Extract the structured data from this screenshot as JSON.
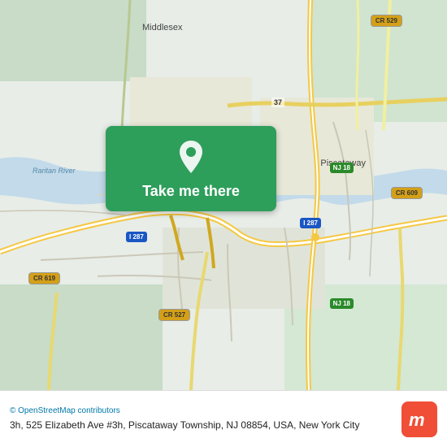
{
  "map": {
    "center_lat": 40.5625,
    "center_lng": -74.4702,
    "zoom": 13
  },
  "button": {
    "label": "Take me there"
  },
  "info_bar": {
    "osm_credit": "© OpenStreetMap contributors",
    "address": "3h, 525 Elizabeth Ave #3h, Piscataway Township, NJ 08854, USA, New York City"
  },
  "labels": {
    "middlesex": "Middlesex",
    "piscataway": "Piscataway",
    "raritan_river": "Raritan River",
    "cr529": "CR 529",
    "cr609": "CR 609",
    "cr619": "CR 619",
    "cr527": "CR 527",
    "i287": "I 287",
    "nj18": "NJ 18",
    "nj37": "37",
    "nj287": "287"
  },
  "moovit": {
    "logo_letter": "m"
  }
}
